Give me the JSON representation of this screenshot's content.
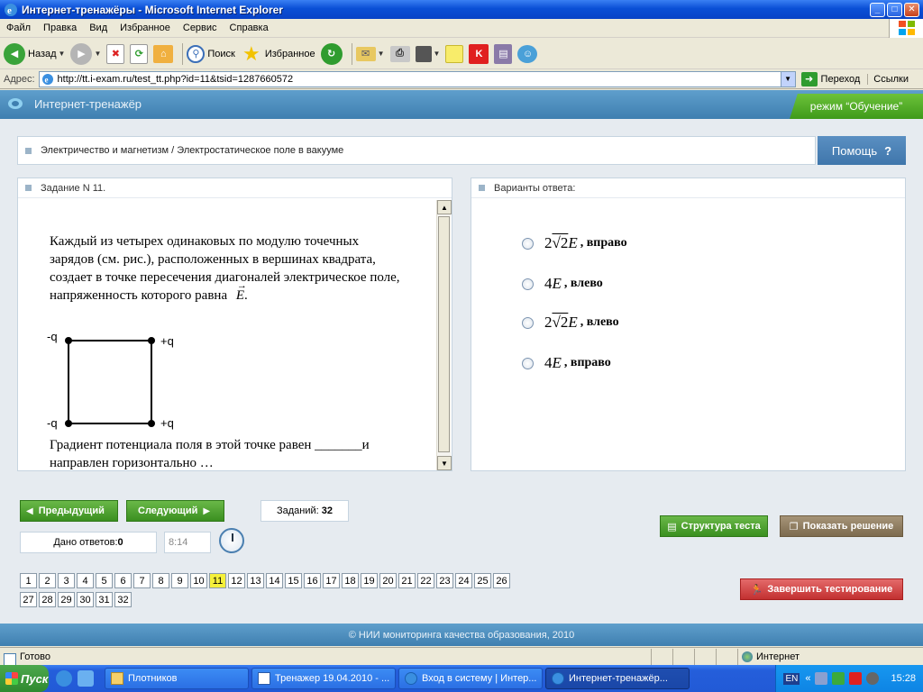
{
  "window": {
    "title": "Интернет-тренажёры - Microsoft Internet Explorer",
    "min": "_",
    "max": "□",
    "close": "✕"
  },
  "menu": [
    "Файл",
    "Правка",
    "Вид",
    "Избранное",
    "Сервис",
    "Справка"
  ],
  "toolbar": {
    "back": "Назад",
    "search": "Поиск",
    "favorites": "Избранное"
  },
  "address": {
    "label": "Адрес:",
    "url": "http://tt.i-exam.ru/test_tt.php?id=11&tsid=1287660572",
    "go": "Переход",
    "links": "Ссылки"
  },
  "site": {
    "title": "Интернет-тренажёр",
    "mode": "режим “Обучение”",
    "breadcrumb": "Электричество и магнетизм / Электростатическое поле в вакууме",
    "help": "Помощь",
    "help_q": "?"
  },
  "task": {
    "header": "Задание N 11.",
    "text1": "Каждый из четырех одинаковых по модулю точечных зарядов (см. рис.), расположенных в вершинах квадрата, создает в точке пересечения диагоналей электрическое поле, напряженность которого равна",
    "evec": "E",
    "dot": ".",
    "text2": "Градиент потенциала поля в этой точке равен _______и направлен горизонтально …",
    "charges": {
      "tl": "-q",
      "tr": "+q",
      "bl": "-q",
      "br": "+q"
    }
  },
  "answers": {
    "header": "Варианты ответа:",
    "options": [
      {
        "coef": "2",
        "root": "√2",
        "var": "E",
        "dir": ", вправо"
      },
      {
        "coef": "4",
        "root": "",
        "var": "E",
        "dir": ", влево"
      },
      {
        "coef": "2",
        "root": "√2",
        "var": "E",
        "dir": ", влево"
      },
      {
        "coef": "4",
        "root": "",
        "var": "E",
        "dir": ", вправо"
      }
    ]
  },
  "nav": {
    "prev": "Предыдущий",
    "next": "Следующий",
    "tasks_label": "Заданий:",
    "tasks_count": "32",
    "answered_label": "Дано ответов:",
    "answered_count": "0",
    "timer": "8:14",
    "structure": "Структура теста",
    "solution": "Показать решение",
    "finish": "Завершить тестирование",
    "current": 11,
    "numbers": [
      "1",
      "2",
      "3",
      "4",
      "5",
      "6",
      "7",
      "8",
      "9",
      "10",
      "11",
      "12",
      "13",
      "14",
      "15",
      "16",
      "17",
      "18",
      "19",
      "20",
      "21",
      "22",
      "23",
      "24",
      "25",
      "26",
      "27",
      "28",
      "29",
      "30",
      "31",
      "32"
    ]
  },
  "footer": "© НИИ мониторинга качества образования, 2010",
  "status": {
    "ready": "Готово",
    "zone": "Интернет"
  },
  "taskbar": {
    "start": "Пуск",
    "tasks": [
      "Плотников",
      "Тренажер 19.04.2010 - ...",
      "Вход в систему | Интер...",
      "Интернет-тренажёр..."
    ],
    "lang": "EN",
    "clock": "15:28"
  },
  "colors": {
    "accent_blue": "#3f7fb0",
    "green": "#3a8f20",
    "brown": "#7c6a4e",
    "red": "#c23030",
    "active_number": "#f5f03a"
  }
}
